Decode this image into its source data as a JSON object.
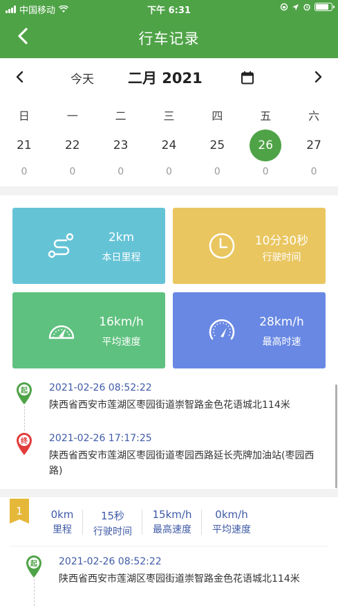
{
  "status_bar": {
    "carrier": "中国移动",
    "time": "下午 6:31",
    "battery_level": 0.9
  },
  "nav": {
    "title": "行车记录",
    "back_icon": "chevron-left-icon"
  },
  "calendar": {
    "today_label": "今天",
    "month_label": "二月 2021",
    "weekdays": [
      "日",
      "一",
      "二",
      "三",
      "四",
      "五",
      "六"
    ],
    "dates": [
      "21",
      "22",
      "23",
      "24",
      "25",
      "26",
      "27"
    ],
    "counts": [
      "0",
      "0",
      "0",
      "0",
      "0",
      "0",
      "0"
    ],
    "selected_date": "26"
  },
  "stats": [
    {
      "value": "2km",
      "label": "本日里程",
      "icon": "route-icon",
      "color": "#65c3d6"
    },
    {
      "value": "10分30秒",
      "label": "行驶时间",
      "icon": "clock-icon",
      "color": "#e9c660"
    },
    {
      "value": "16km/h",
      "label": "平均速度",
      "icon": "speedometer-icon",
      "color": "#5fc17f"
    },
    {
      "value": "28km/h",
      "label": "最高时速",
      "icon": "speed-gauge-icon",
      "color": "#6888e3"
    }
  ],
  "route": {
    "start": {
      "pin_label": "起",
      "time": "2021-02-26 08:52:22",
      "address": "陕西省西安市莲湖区枣园街道崇智路金色花语城北114米"
    },
    "end": {
      "pin_label": "终",
      "time": "2021-02-26 17:17:25",
      "address": "陕西省西安市莲湖区枣园街道枣园西路延长壳牌加油站(枣园西路)"
    }
  },
  "segment": {
    "index": "1",
    "metrics": [
      {
        "value": "0km",
        "label": "里程"
      },
      {
        "value": "15秒",
        "label": "行驶时间"
      },
      {
        "value": "15km/h",
        "label": "最高速度"
      },
      {
        "value": "0km/h",
        "label": "平均速度"
      }
    ],
    "start": {
      "pin_label": "起",
      "time": "2021-02-26 08:52:22",
      "address": "陕西省西安市莲湖区枣园街道崇智路金色花语城北114米"
    }
  },
  "colors": {
    "primary": "#4fa347",
    "start_pin": "#4fa347",
    "end_pin": "#e33b3b",
    "flag": "#e6b83a",
    "link_text": "#3e5aa6"
  }
}
